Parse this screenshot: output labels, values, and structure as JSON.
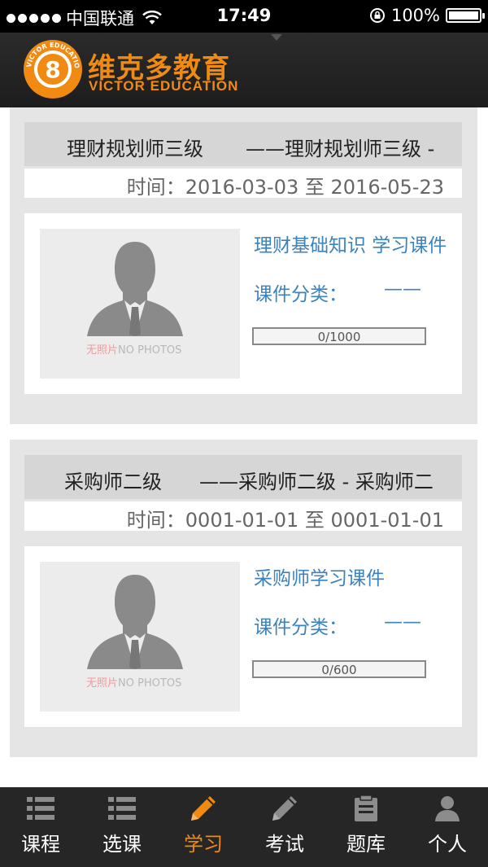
{
  "status_bar": {
    "carrier": "中国联通",
    "time": "17:49",
    "battery": "100%",
    "signal_icon": "signal-dots-icon",
    "wifi_icon": "wifi-icon",
    "lock_icon": "rotation-lock-icon",
    "battery_icon": "battery-icon",
    "battery_level": 1.0
  },
  "header": {
    "logo_badge_text": "VICTOR EDUCATION · 维克多教育",
    "brand_cn": "维克多教育",
    "brand_en": "VICTOR EDUCATION",
    "accent_color": "#f08a12"
  },
  "courses": [
    {
      "title": "理财规划师三级",
      "subtitle": "——理财规划师三级 -",
      "time_label": "时间：2016-03-03 至 2016-05-23",
      "photo_cn": "无照片",
      "photo_en": "NO PHOTOS",
      "courseware_name": "理财基础知识 学习课件",
      "category_label": "课件分类：",
      "category_value": "——",
      "progress_text": "0/1000",
      "progress": 0
    },
    {
      "title": "采购师二级",
      "subtitle": "——采购师二级 - 采购师二",
      "time_label": "时间：0001-01-01 至 0001-01-01",
      "photo_cn": "无照片",
      "photo_en": "NO PHOTOS",
      "courseware_name": "采购师学习课件",
      "category_label": "课件分类：",
      "category_value": "——",
      "progress_text": "0/600",
      "progress": 0
    }
  ],
  "tabbar": {
    "active_color": "#f08a12",
    "items": [
      {
        "label": "课程",
        "icon": "list-icon",
        "active": false
      },
      {
        "label": "选课",
        "icon": "list-icon",
        "active": false
      },
      {
        "label": "学习",
        "icon": "pencil-icon",
        "active": true
      },
      {
        "label": "考试",
        "icon": "pencil-icon",
        "active": false
      },
      {
        "label": "题库",
        "icon": "clipboard-icon",
        "active": false
      },
      {
        "label": "个人",
        "icon": "person-icon",
        "active": false
      }
    ]
  }
}
